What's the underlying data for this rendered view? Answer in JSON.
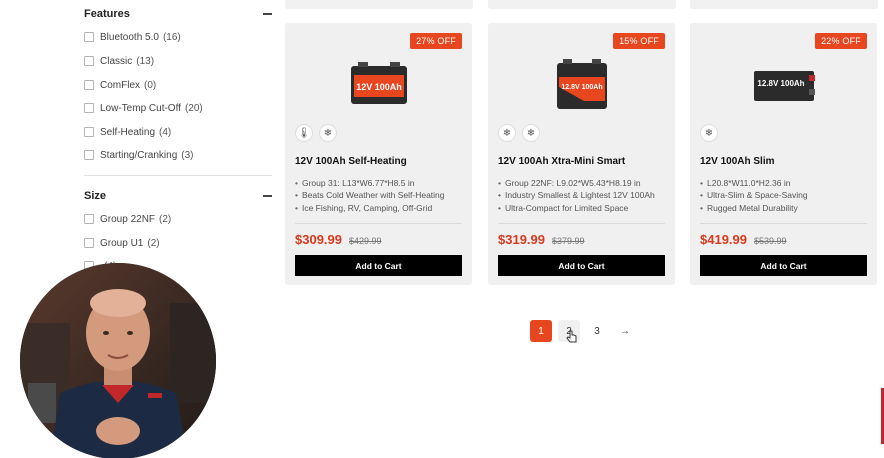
{
  "sidebar": {
    "features": {
      "title": "Features",
      "items": [
        {
          "label": "Bluetooth 5.0",
          "count": "(16)"
        },
        {
          "label": "Classic",
          "count": "(13)"
        },
        {
          "label": "ComFlex",
          "count": "(0)"
        },
        {
          "label": "Low-Temp Cut-Off",
          "count": "(20)"
        },
        {
          "label": "Self-Heating",
          "count": "(4)"
        },
        {
          "label": "Starting/Cranking",
          "count": "(3)"
        }
      ]
    },
    "size": {
      "title": "Size",
      "items": [
        {
          "label": "Group 22NF",
          "count": "(2)"
        },
        {
          "label": "Group U1",
          "count": "(2)"
        },
        {
          "label": "",
          "count": "(4)"
        }
      ]
    }
  },
  "products": [
    {
      "badge": "27% OFF",
      "name": "12V 100Ah Self-Heating",
      "features": [
        "Group 31: L13*W6.77*H8.5 in",
        "Beats Cold Weather with Self-Heating",
        "Ice Fishing, RV, Camping, Off-Grid"
      ],
      "price": "$309.99",
      "old_price": "$429.99",
      "cart_label": "Add to Cart",
      "icons": [
        "thermometer-icon",
        "snowflake-icon"
      ],
      "battery_text": "12V 100Ah"
    },
    {
      "badge": "15% OFF",
      "name": "12V 100Ah Xtra-Mini Smart",
      "features": [
        "Group 22NF: L9.02*W5.43*H8.19 in",
        "Industry Smallest & Lightest 12V 100Ah",
        "Ultra-Compact for Limited Space"
      ],
      "price": "$319.99",
      "old_price": "$379.99",
      "cart_label": "Add to Cart",
      "icons": [
        "snowflake-icon",
        "snowflake-icon"
      ],
      "battery_text": "12.8V 100Ah"
    },
    {
      "badge": "22% OFF",
      "name": "12V 100Ah Slim",
      "features": [
        "L20.8*W11.0*H2.36 in",
        "Ultra-Slim & Space-Saving",
        "Rugged Metal Durability"
      ],
      "price": "$419.99",
      "old_price": "$539.99",
      "cart_label": "Add to Cart",
      "icons": [
        "snowflake-icon"
      ],
      "battery_text": "12.8V 100Ah"
    }
  ],
  "pagination": {
    "pages": [
      "1",
      "2",
      "3"
    ],
    "current": "1",
    "next": "→"
  },
  "colors": {
    "accent": "#e8461f",
    "price": "#d63a1f",
    "button": "#000000"
  }
}
